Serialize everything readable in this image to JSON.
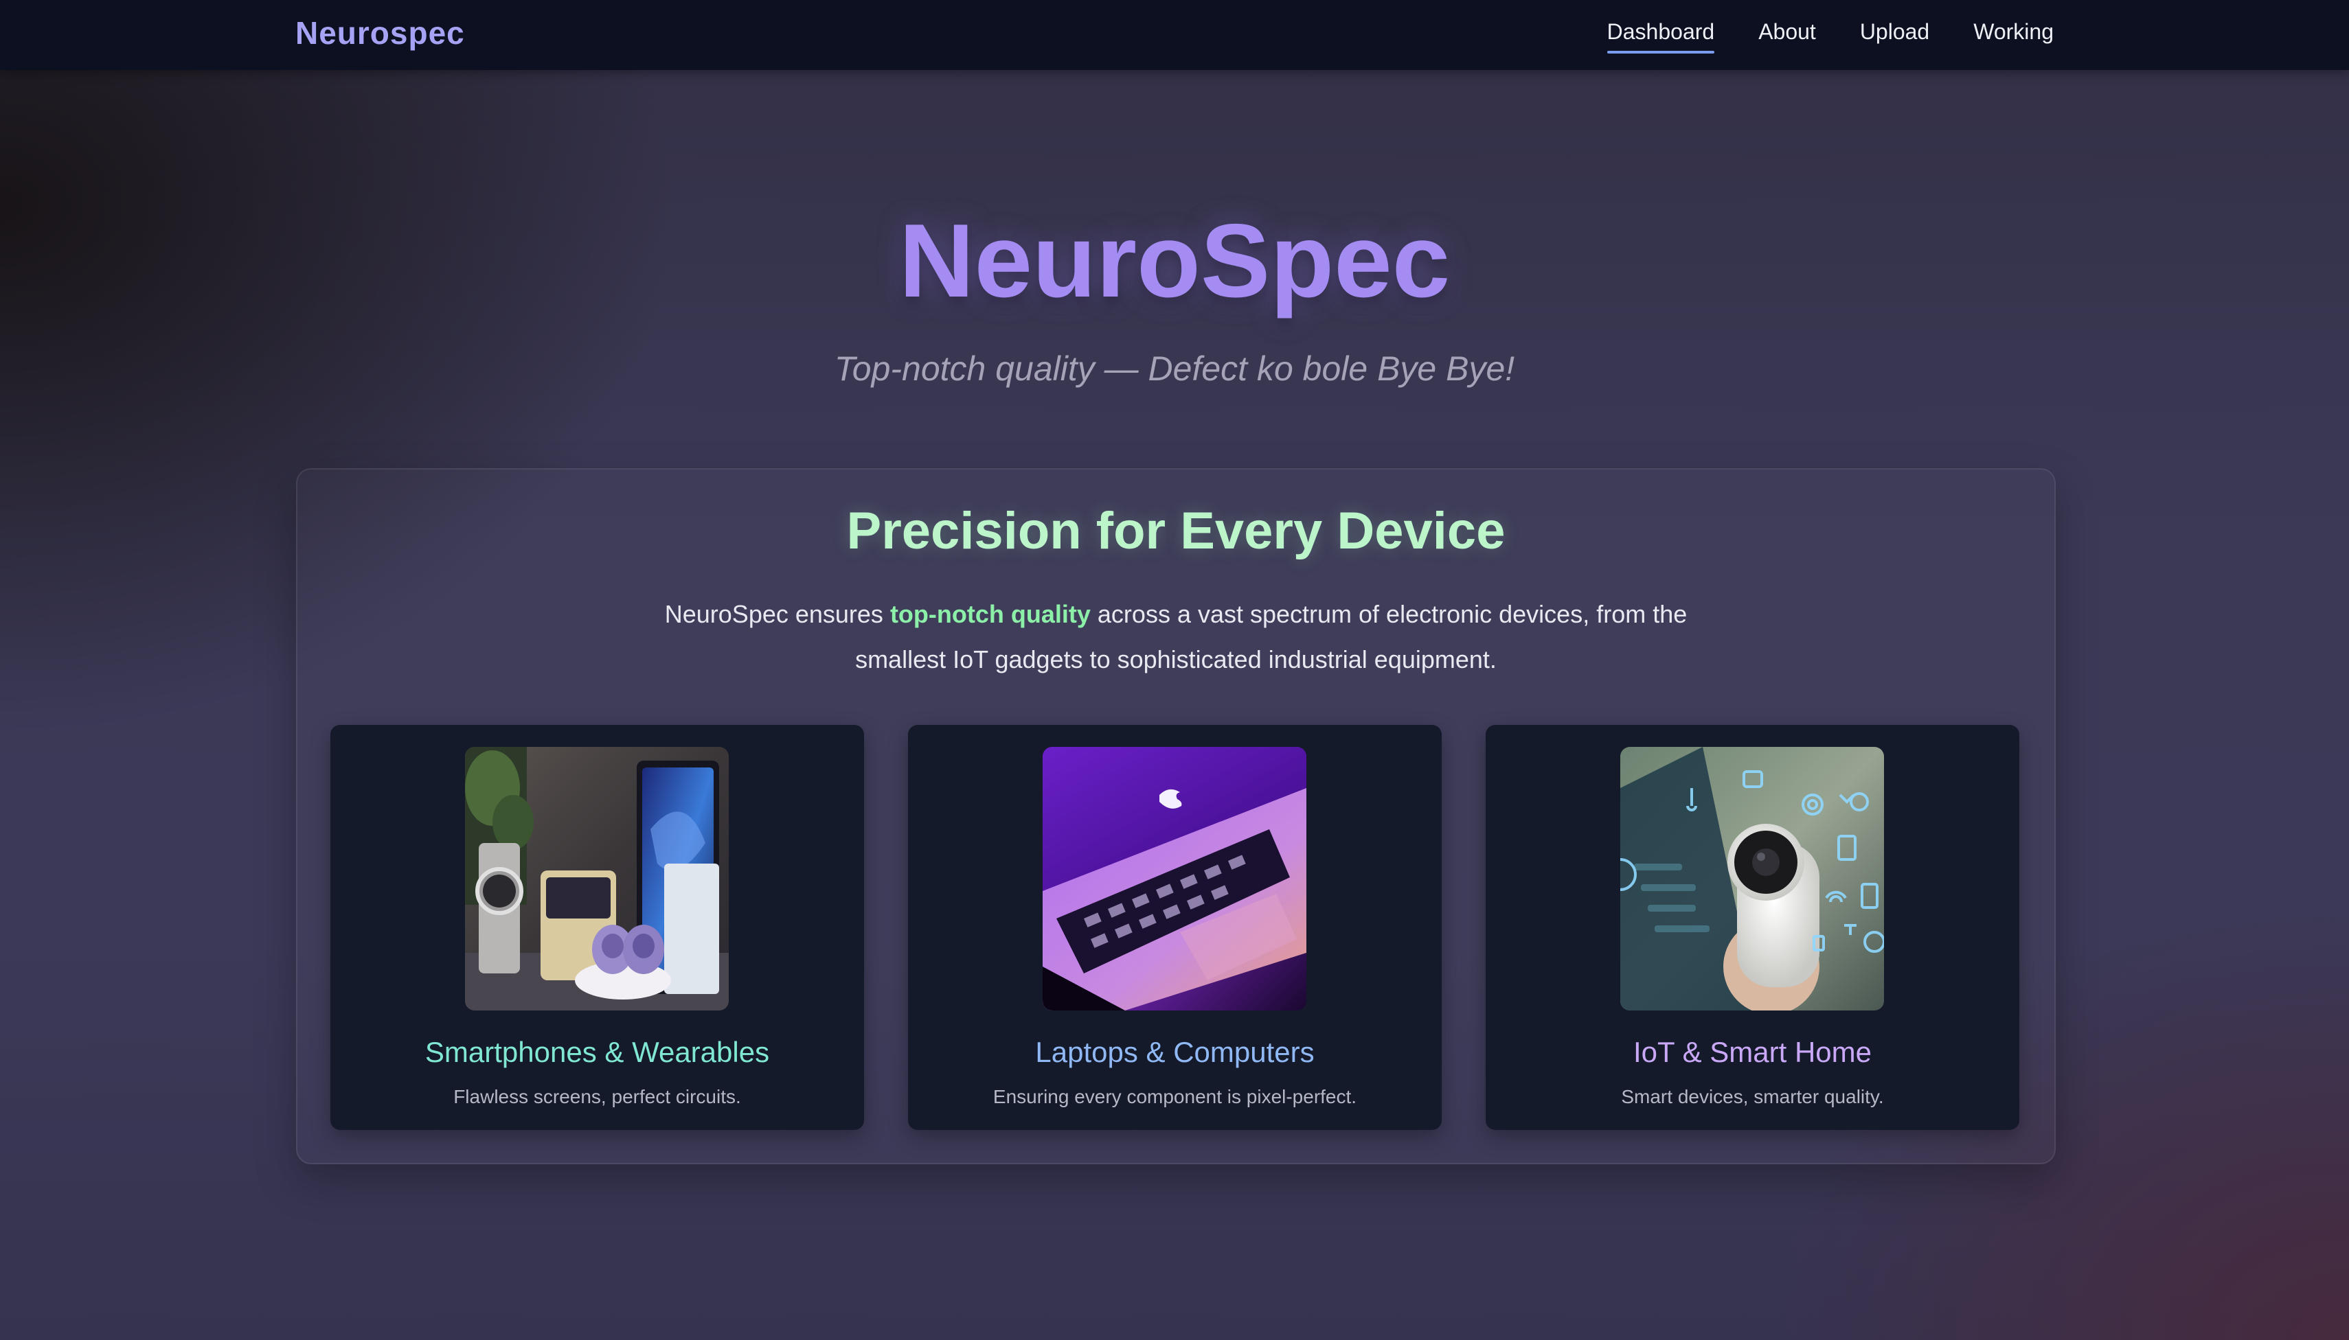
{
  "navbar": {
    "brand": "Neurospec",
    "links": [
      {
        "label": "Dashboard",
        "active": true
      },
      {
        "label": "About",
        "active": false
      },
      {
        "label": "Upload",
        "active": false
      },
      {
        "label": "Working",
        "active": false
      }
    ]
  },
  "hero": {
    "title": "NeuroSpec",
    "subtitle": "Top-notch quality — Defect ko bole Bye Bye!"
  },
  "section": {
    "title": "Precision for Every Device",
    "desc_before": "NeuroSpec ensures ",
    "desc_highlight": "top-notch quality",
    "desc_after": " across a vast spectrum of electronic devices, from the smallest IoT gadgets to sophisticated industrial equipment."
  },
  "cards": [
    {
      "title": "Smartphones & Wearables",
      "text": "Flawless screens, perfect circuits.",
      "title_color": "#7fe7d2",
      "image": "smartphones-wearables-photo"
    },
    {
      "title": "Laptops & Computers",
      "text": "Ensuring every component is pixel-perfect.",
      "title_color": "#8fb8f4",
      "image": "laptop-keyboard-photo"
    },
    {
      "title": "IoT & Smart Home",
      "text": "Smart devices, smarter quality.",
      "title_color": "#c8a8f7",
      "image": "smart-home-camera-photo"
    }
  ],
  "colors": {
    "navbar_bg": "#0c1020",
    "brand": "#a6a3f4",
    "hero_title": "#a48cf3",
    "section_title": "#bcf5c9",
    "highlight": "#8cf0a8",
    "card_bg": "#151a2a",
    "nav_underline": "#7c9cf0"
  }
}
